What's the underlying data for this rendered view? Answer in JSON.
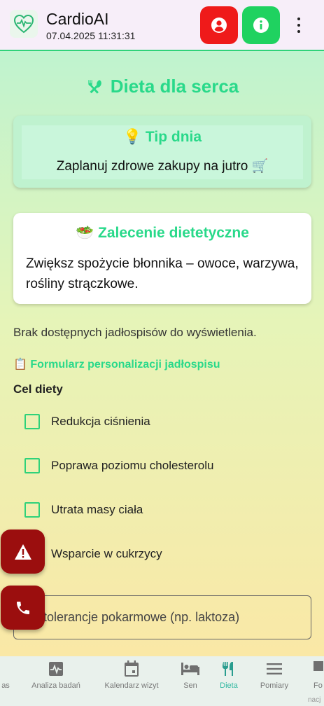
{
  "app": {
    "title": "CardioAI",
    "datetime": "07.04.2025 11:31:31"
  },
  "header": {
    "logo_icon": "heart-pulse-icon",
    "profile_button_icon": "user-icon",
    "info_button_icon": "info-icon",
    "menu_icon": "more-vert-icon",
    "profile_color": "#ef1a1a",
    "info_color": "#1fd260"
  },
  "page": {
    "title": "Dieta dla serca",
    "title_icon": "utensils-icon",
    "accent_color": "#29d98a"
  },
  "tip": {
    "title": "💡 Tip dnia",
    "text": "Zaplanuj zdrowe zakupy na jutro 🛒"
  },
  "recommendation": {
    "title": "🥗 Zalecenie dietetyczne",
    "text": "Zwiększ spożycie błonnika – owoce, warzywa, rośliny strączkowe."
  },
  "menus": {
    "empty_message": "Brak dostępnych jadłospisów do wyświetlenia."
  },
  "form": {
    "link": "📋 Formularz personalizacji jadłospisu",
    "goal_label": "Cel diety",
    "goals": [
      {
        "label": "Redukcja ciśnienia",
        "checked": false
      },
      {
        "label": "Poprawa poziomu cholesterolu",
        "checked": false
      },
      {
        "label": "Utrata masy ciała",
        "checked": false
      },
      {
        "label": "Wsparcie w cukrzycy",
        "checked": false
      }
    ],
    "intolerance_placeholder": "Nietolerancje pokarmowe (np. laktoza)",
    "intolerance_visible": "tolerancje pokarmowe (np. laktoza)"
  },
  "fabs": {
    "alert_icon": "warning-icon",
    "phone_icon": "phone-icon",
    "color": "#9b0e0e"
  },
  "bottom_nav": {
    "items": [
      {
        "label": "as",
        "icon": ""
      },
      {
        "label": "Analiza badań",
        "icon": "pulse-chart-icon"
      },
      {
        "label": "Kalendarz wizyt",
        "icon": "calendar-icon"
      },
      {
        "label": "Sen",
        "icon": "bed-icon"
      },
      {
        "label": "Dieta",
        "icon": "utensils-icon",
        "active": true
      },
      {
        "label": "Pomiary",
        "icon": "list-icon"
      },
      {
        "label": "Fo",
        "icon": "flag-icon"
      }
    ],
    "trailing_fragment": "nacj"
  }
}
